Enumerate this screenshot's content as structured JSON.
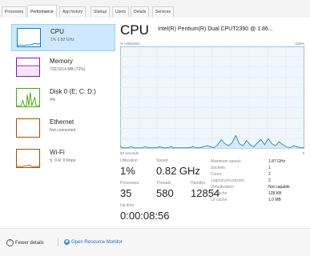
{
  "tabs": [
    "Processes",
    "Performance",
    "App history",
    "Startup",
    "Users",
    "Details",
    "Services"
  ],
  "active_tab": "Performance",
  "sidebar": {
    "items": [
      {
        "name": "CPU",
        "sub": "1% 0.82 GHz",
        "selected": true,
        "color": "#117dbb"
      },
      {
        "name": "Memory",
        "sub": "732/1014 MB (72%)",
        "selected": false,
        "color": "#8b12ae"
      },
      {
        "name": "Disk 0 (E: C: D:)",
        "sub": "4%",
        "selected": false,
        "color": "#4da60c"
      },
      {
        "name": "Ethernet",
        "sub": "Not connected",
        "selected": false,
        "color": "#a74f01"
      },
      {
        "name": "Wi-Fi",
        "sub": "S: 0 R: 0 Kbps",
        "selected": false,
        "color": "#a74f01"
      }
    ]
  },
  "cpu": {
    "title": "CPU",
    "model": "Intel(R) Pentium(R) Dual CPUT2390 @ 1.86...",
    "util_label": "% Utilization",
    "util_max": "100%",
    "secs_label": "60 seconds",
    "zero_label": "0",
    "graph_color": "#117dbb",
    "graph_fill": "#f1f6fa",
    "utilization_percent": [
      2,
      1,
      1,
      2,
      1,
      1,
      1,
      2,
      1,
      1,
      1,
      2,
      1,
      1,
      2,
      1,
      1,
      1,
      1,
      1,
      2,
      1,
      1,
      2,
      3,
      2,
      1,
      4,
      9,
      5,
      3,
      6,
      13,
      5,
      3,
      8,
      4,
      2,
      6,
      9,
      4,
      10,
      5,
      3,
      7,
      4,
      2,
      1,
      3,
      2,
      1,
      1
    ]
  },
  "stats": {
    "utilization": {
      "label": "Utilization",
      "value": "1%"
    },
    "speed": {
      "label": "Speed",
      "value": "0.82 GHz"
    },
    "processes": {
      "label": "Processes",
      "value": "35"
    },
    "threads": {
      "label": "Threads",
      "value": "580"
    },
    "handles": {
      "label": "Handles",
      "value": "12854"
    },
    "uptime": {
      "label": "Up time",
      "value": "0:00:08:56"
    }
  },
  "details": [
    {
      "label": "Maximum speed:",
      "value": "1.87 GHz"
    },
    {
      "label": "Sockets:",
      "value": "1"
    },
    {
      "label": "Cores:",
      "value": "2"
    },
    {
      "label": "Logical processors:",
      "value": "2"
    },
    {
      "label": "Virtualization:",
      "value": "Not capable"
    },
    {
      "label": "L1 cache:",
      "value": "128 KB"
    },
    {
      "label": "L2 cache:",
      "value": "1.0 MB"
    }
  ],
  "footer": {
    "fewer_details": "Fewer details",
    "open_monitor": "Open Resource Monitor"
  }
}
